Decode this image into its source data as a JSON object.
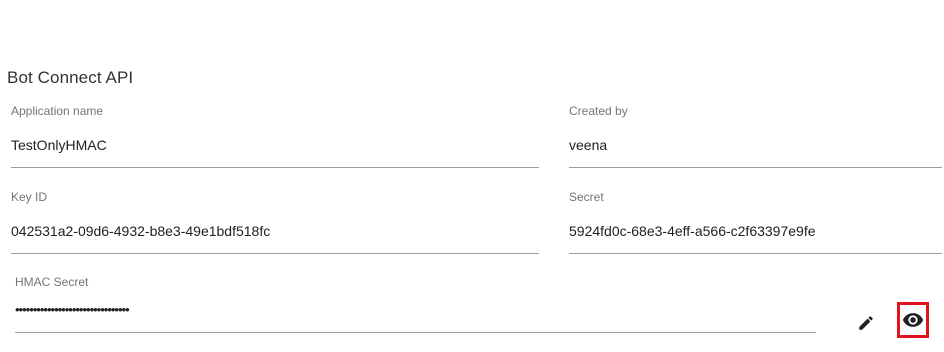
{
  "section": {
    "title": "Bot Connect API"
  },
  "fields": {
    "application_name": {
      "label": "Application name",
      "value": "TestOnlyHMAC"
    },
    "created_by": {
      "label": "Created by",
      "value": "veena"
    },
    "key_id": {
      "label": "Key ID",
      "value": "042531a2-09d6-4932-b8e3-49e1bdf518fc"
    },
    "secret": {
      "label": "Secret",
      "value": "5924fd0c-68e3-4eff-a566-c2f63397e9fe"
    },
    "hmac_secret": {
      "label": "HMAC Secret",
      "value": "••••••••••••••••••••••••••••••••"
    }
  },
  "actions": {
    "edit_icon": "pencil-icon",
    "view_icon": "eye-icon",
    "highlight_color": "#e0141e"
  }
}
